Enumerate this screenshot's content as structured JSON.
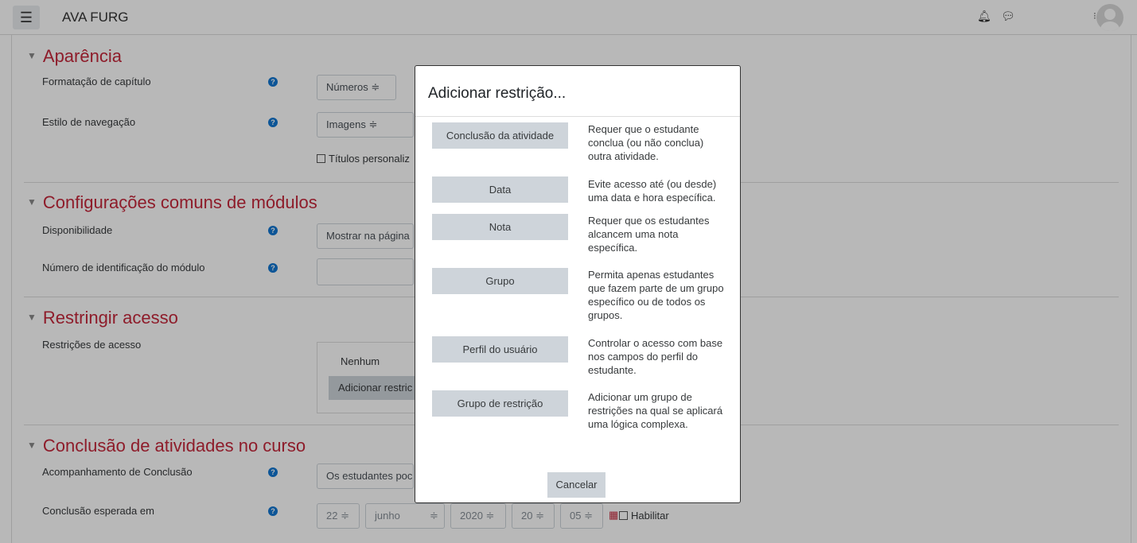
{
  "header": {
    "menu_icon": "hamburger-icon",
    "site_name": "AVA FURG",
    "notifications_icon": "bell-icon",
    "messages_icon": "chat-icon",
    "user_menu_dots": "⁝",
    "avatar_icon": "user-avatar-icon"
  },
  "form": {
    "appearance": {
      "title": "Aparência",
      "chapter_format_label": "Formatação de capítulo",
      "chapter_format_value": "Números ≑",
      "nav_style_label": "Estilo de navegação",
      "nav_style_value": "Imagens ≑",
      "custom_titles_label": "Títulos personaliz"
    },
    "common_modules": {
      "title": "Configurações comuns de módulos",
      "availability_label": "Disponibilidade",
      "availability_value": "Mostrar na página",
      "idnumber_label": "Número de identificação do módulo",
      "idnumber_value": ""
    },
    "restrict": {
      "title": "Restringir acesso",
      "restrictions_label": "Restrições de acesso",
      "none_text": "Nenhum",
      "add_button": "Adicionar restric"
    },
    "completion": {
      "title": "Conclusão de atividades no curso",
      "tracking_label": "Acompanhamento de Conclusão",
      "tracking_value": "Os estudantes poc",
      "expected_label": "Conclusão esperada em",
      "day": "22 ≑",
      "month": "junho",
      "month_arrow": "≑",
      "year": "2020 ≑",
      "hour": "20 ≑",
      "minute": "05 ≑",
      "calendar_icon": "calendar-icon",
      "enable_label": "Habilitar"
    }
  },
  "modal": {
    "title": "Adicionar restrição...",
    "options": [
      {
        "label": "Conclusão da atividade",
        "description": "Requer que o estudante conclua (ou não conclua) outra atividade."
      },
      {
        "label": "Data",
        "description": "Evite acesso até (ou desde) uma data e hora específica."
      },
      {
        "label": "Nota",
        "description": "Requer que os estudantes alcancem uma nota específica."
      },
      {
        "label": "Grupo",
        "description": "Permita apenas estudantes que fazem parte de um grupo específico ou de todos os grupos."
      },
      {
        "label": "Perfil do usuário",
        "description": "Controlar o acesso com base nos campos do perfil do estudante."
      },
      {
        "label": "Grupo de restrição",
        "description": "Adicionar um grupo de restrições na qual se aplicará uma lógica complexa."
      }
    ],
    "cancel_label": "Cancelar"
  }
}
